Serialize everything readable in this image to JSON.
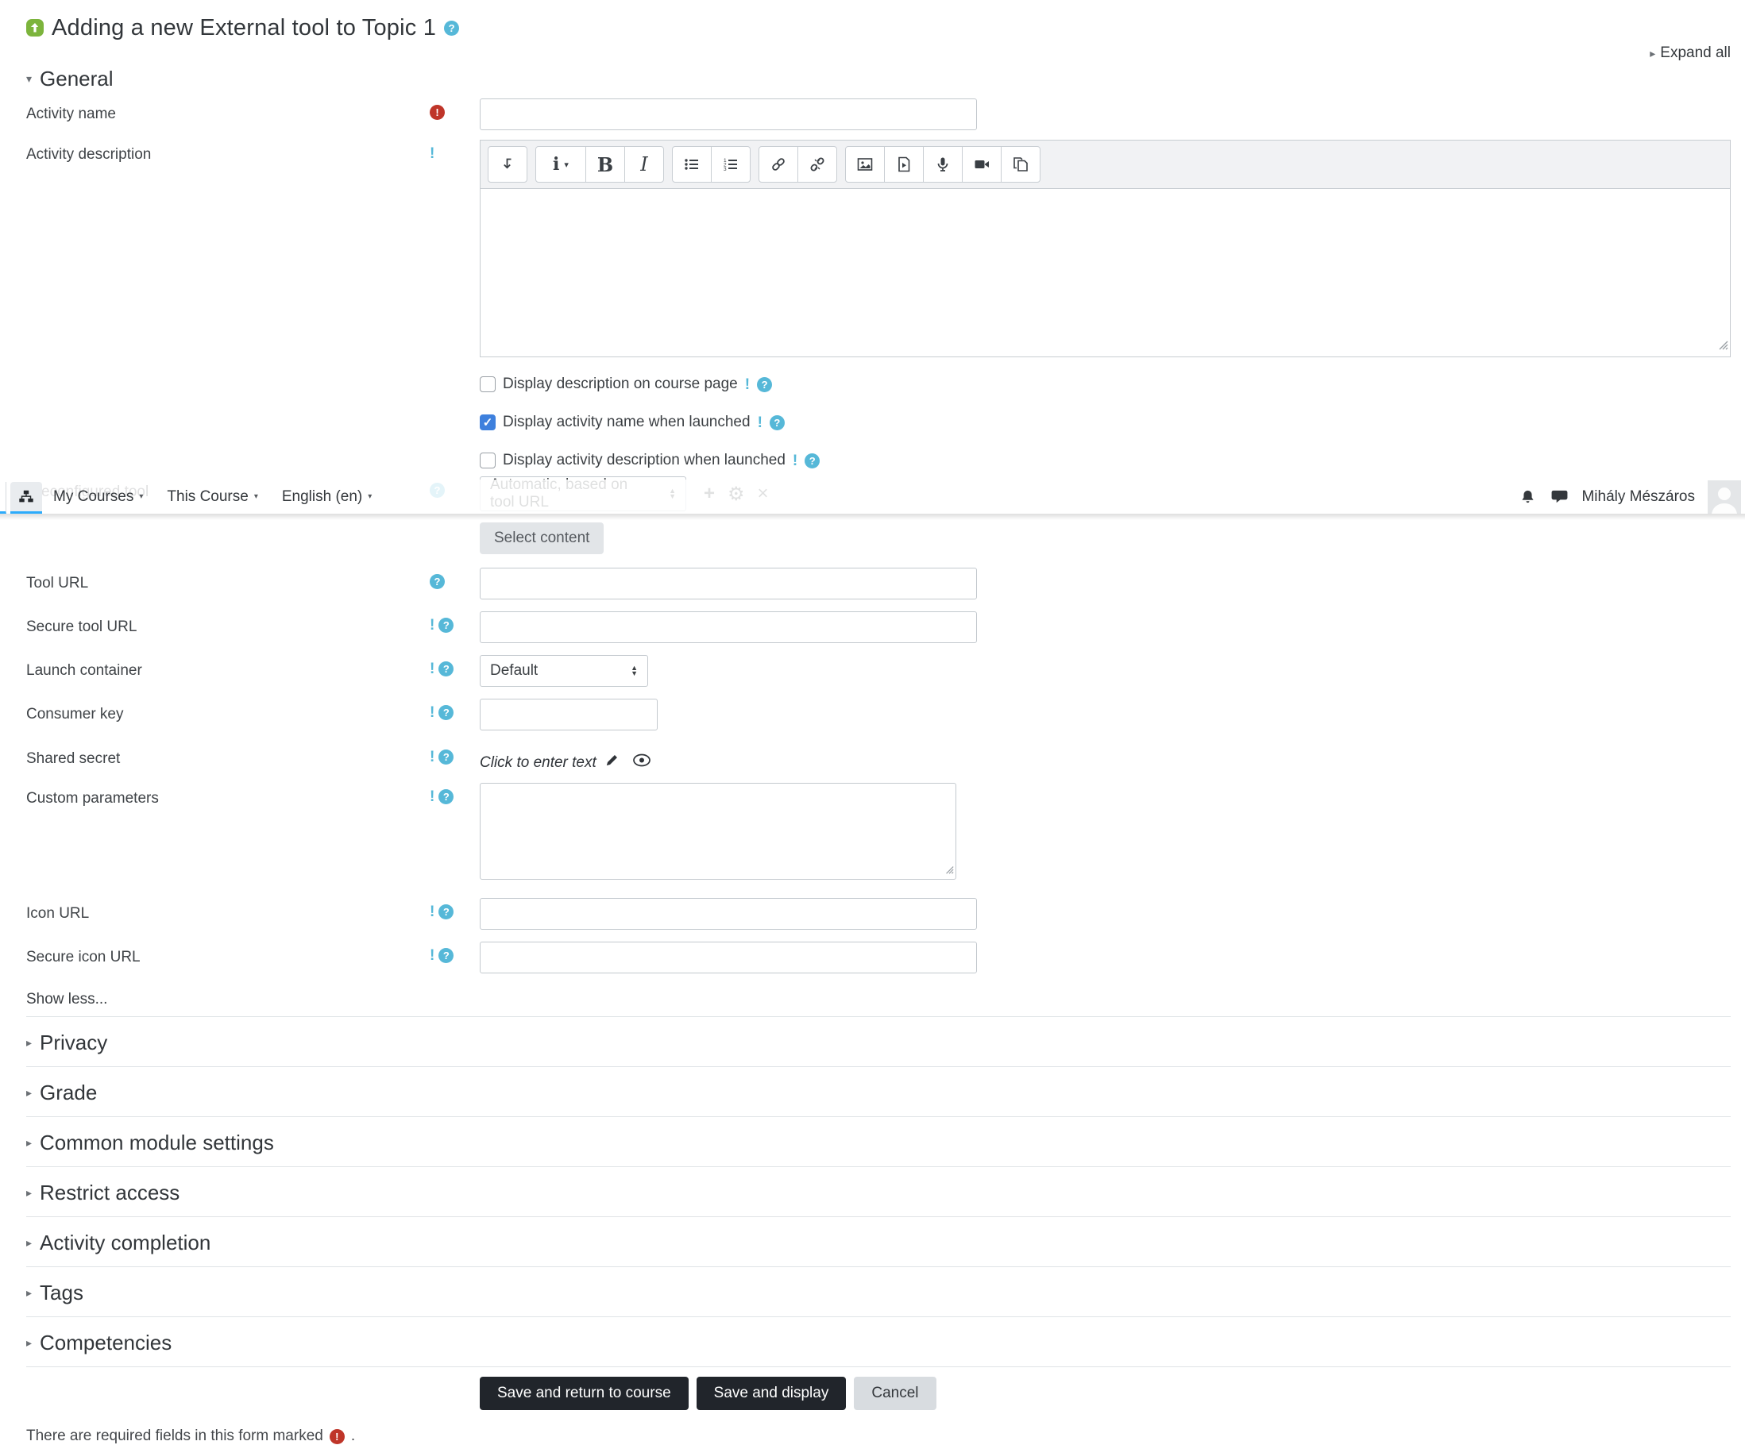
{
  "header": {
    "title": "Adding a new External tool to Topic 1",
    "expand_all": "Expand all"
  },
  "navbar": {
    "menus": [
      "My Courses",
      "This Course",
      "English (en)"
    ],
    "user_name": "Mihály Mészáros",
    "icons": [
      "sitemap-icon",
      "bell-icon",
      "messages-icon",
      "avatar"
    ]
  },
  "form": {
    "general_heading": "General",
    "rows": {
      "activity_name": {
        "label": "Activity name"
      },
      "activity_description": {
        "label": "Activity description"
      },
      "preconfigured_tool": {
        "label": "Preconfigured tool",
        "selected": "Automatic, based on tool URL"
      },
      "tool_url": {
        "label": "Tool URL"
      },
      "secure_tool_url": {
        "label": "Secure tool URL"
      },
      "launch_container": {
        "label": "Launch container",
        "selected": "Default"
      },
      "consumer_key": {
        "label": "Consumer key"
      },
      "shared_secret": {
        "label": "Shared secret",
        "value": "Click to enter text"
      },
      "custom_parameters": {
        "label": "Custom parameters"
      },
      "icon_url": {
        "label": "Icon URL"
      },
      "secure_icon_url": {
        "label": "Secure icon URL"
      }
    },
    "checkboxes": [
      {
        "label": "Display description on course page",
        "checked": false
      },
      {
        "label": "Display activity name when launched",
        "checked": true
      },
      {
        "label": "Display activity description when launched",
        "checked": false
      }
    ],
    "select_content_button": "Select content",
    "show_less": "Show less...",
    "sections": [
      "Privacy",
      "Grade",
      "Common module settings",
      "Restrict access",
      "Activity completion",
      "Tags",
      "Competencies"
    ],
    "buttons": {
      "save_return": "Save and return to course",
      "save_display": "Save and display",
      "cancel": "Cancel"
    },
    "footer_note": "There are required fields in this form marked",
    "footer_period": "."
  },
  "editor": {
    "toolbar_icons": [
      "collapse-toolbar-icon",
      "paragraph-styles-icon",
      "bold-icon",
      "italic-icon",
      "unordered-list-icon",
      "ordered-list-icon",
      "link-icon",
      "unlink-icon",
      "image-icon",
      "media-icon",
      "record-audio-icon",
      "record-video-icon",
      "manage-files-icon"
    ]
  },
  "colors": {
    "info_cyan": "#56b8d8",
    "required_red": "#bf3529",
    "primary_button_dark": "#21252b",
    "checkbox_checked_blue": "#3e80dd",
    "nav_active_underline": "#2cabfb",
    "activity_icon_green": "#7cb43c"
  }
}
